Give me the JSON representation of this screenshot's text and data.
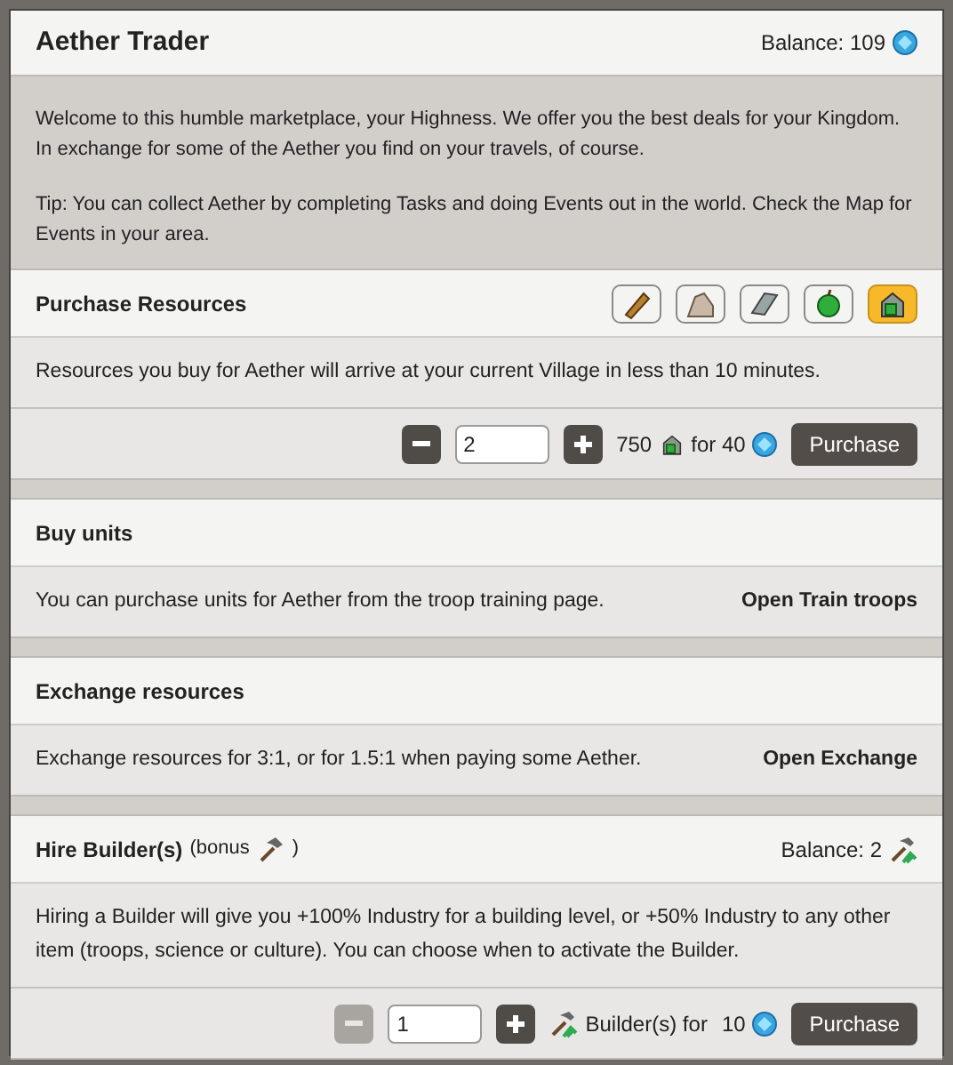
{
  "title": "Aether Trader",
  "balance": "Balance: 109",
  "intro": [
    "Welcome to this humble marketplace, your Highness. We offer you the best deals for your Kingdom. In exchange for some of the Aether you find on your travels, of course.",
    "Tip: You can collect Aether by completing Tasks and doing Events out in the world. Check the Map for Events in your area."
  ],
  "sections": [
    {
      "kind": "purchase",
      "title": "Purchase Resources",
      "resources": [
        {
          "kind": "wood",
          "selected": false
        },
        {
          "kind": "stone",
          "selected": false
        },
        {
          "kind": "metal",
          "selected": false
        },
        {
          "kind": "food",
          "selected": false
        },
        {
          "kind": "bundle",
          "selected": true
        }
      ],
      "description": "Resources you buy for Aether will arrive at your current Village in less than 10 minutes.",
      "quantity": "2",
      "minus_disabled": false,
      "amount": "750",
      "price": "for 40",
      "button": "Purchase"
    },
    {
      "kind": "link",
      "title": "Buy units",
      "description": "You can purchase units for Aether from the troop training page.",
      "link": "Open Train troops"
    },
    {
      "kind": "link",
      "title": "Exchange resources",
      "description": "Exchange resources for 3:1, or for 1.5:1 when paying some Aether.",
      "link": "Open Exchange"
    },
    {
      "kind": "builder",
      "title": "Hire Builder(s)",
      "bonus_open": "(bonus",
      "bonus_close": ")",
      "balance": "Balance: 2",
      "description": "Hiring a Builder will give you +100% Industry for a building level, or +50% Industry to any other item (troops, science or culture). You can choose when to activate the Builder.",
      "quantity": "1",
      "minus_disabled": true,
      "unit": "Builder(s) for",
      "price": "10",
      "button": "Purchase"
    }
  ]
}
